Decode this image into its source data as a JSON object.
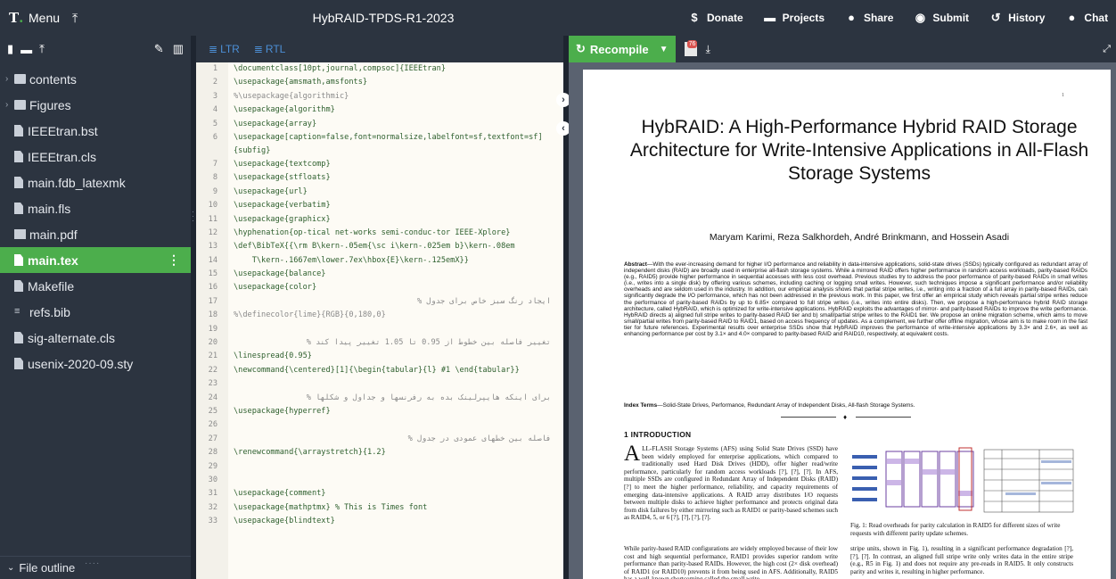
{
  "topbar": {
    "menu_label": "Menu",
    "title": "HybRAID-TPDS-R1-2023",
    "actions": [
      {
        "icon": "dollar-icon",
        "label": "Donate"
      },
      {
        "icon": "folder-icon",
        "label": "Projects"
      },
      {
        "icon": "users-icon",
        "label": "Share"
      },
      {
        "icon": "submit-icon",
        "label": "Submit"
      },
      {
        "icon": "history-icon",
        "label": "History"
      },
      {
        "icon": "chat-icon",
        "label": "Chat"
      }
    ]
  },
  "file_tree": {
    "items": [
      {
        "label": "contents",
        "type": "folder"
      },
      {
        "label": "Figures",
        "type": "folder"
      },
      {
        "label": "IEEEtran.bst",
        "type": "file"
      },
      {
        "label": "IEEEtran.cls",
        "type": "file"
      },
      {
        "label": "main.fdb_latexmk",
        "type": "file"
      },
      {
        "label": "main.fls",
        "type": "file"
      },
      {
        "label": "main.pdf",
        "type": "image"
      },
      {
        "label": "main.tex",
        "type": "file",
        "active": true
      },
      {
        "label": "Makefile",
        "type": "file"
      },
      {
        "label": "refs.bib",
        "type": "bib"
      },
      {
        "label": "sig-alternate.cls",
        "type": "file"
      },
      {
        "label": "usenix-2020-09.sty",
        "type": "file"
      }
    ],
    "outline_label": "File outline"
  },
  "editor": {
    "ltr_label": "LTR",
    "rtl_label": "RTL",
    "lines": [
      {
        "n": "1",
        "code": "\\documentclass[10pt,journal,compsoc]{IEEEtran}"
      },
      {
        "n": "2",
        "code": "\\usepackage{amsmath,amsfonts}"
      },
      {
        "n": "3",
        "code": "%\\usepackage{algorithmic}",
        "comment": true
      },
      {
        "n": "4",
        "code": "\\usepackage{algorithm}"
      },
      {
        "n": "5",
        "code": "\\usepackage{array}"
      },
      {
        "n": "6",
        "code": "\\usepackage[caption=false,font=normalsize,labelfont=sf,textfont=sf]",
        "code2": "{subfig}"
      },
      {
        "n": "7",
        "code": "\\usepackage{textcomp}"
      },
      {
        "n": "8",
        "code": "\\usepackage{stfloats}"
      },
      {
        "n": "9",
        "code": "\\usepackage{url}"
      },
      {
        "n": "10",
        "code": "\\usepackage{verbatim}"
      },
      {
        "n": "11",
        "code": "\\usepackage{graphicx}"
      },
      {
        "n": "12",
        "code": "\\hyphenation{op-tical net-works semi-conduc-tor IEEE-Xplore}"
      },
      {
        "n": "13",
        "code": "\\def\\BibTeX{{\\rm B\\kern-.05em{\\sc i\\kern-.025em b}\\kern-.08em"
      },
      {
        "n": "14",
        "code": "    T\\kern-.1667em\\lower.7ex\\hbox{E}\\kern-.125emX}}"
      },
      {
        "n": "15",
        "code": "\\usepackage{balance}"
      },
      {
        "n": "16",
        "code": "\\usepackage{color}"
      },
      {
        "n": "17",
        "code": "ایجاد رنگ سبز خاص برای جدول %",
        "comment": true,
        "rtl": true
      },
      {
        "n": "18",
        "code": "%\\definecolor{lime}{RGB}{0,180,0}",
        "comment": true
      },
      {
        "n": "19",
        "code": ""
      },
      {
        "n": "20",
        "code": "تغییر فاصله بین خطوط از 0.95 تا 1.05 تغییر پیدا کند %",
        "comment": true,
        "rtl": true
      },
      {
        "n": "21",
        "code": "\\linespread{0.95}"
      },
      {
        "n": "22",
        "code": "\\newcommand{\\centered}[1]{\\begin{tabular}{l} #1 \\end{tabular}}"
      },
      {
        "n": "23",
        "code": ""
      },
      {
        "n": "24",
        "code": "برای اینکه هایپرلینک بده به رفرنسها و جداول و شکلها %",
        "comment": true,
        "rtl": true
      },
      {
        "n": "25",
        "code": "\\usepackage{hyperref}"
      },
      {
        "n": "26",
        "code": ""
      },
      {
        "n": "27",
        "code": "فاصله بین خطهای عمودی در جدول %",
        "comment": true,
        "rtl": true
      },
      {
        "n": "28",
        "code": "\\renewcommand{\\arraystretch}{1.2}"
      },
      {
        "n": "29",
        "code": ""
      },
      {
        "n": "30",
        "code": ""
      },
      {
        "n": "31",
        "code": "\\usepackage{comment}"
      },
      {
        "n": "32",
        "code": "\\usepackage{mathptmx} % This is Times font"
      },
      {
        "n": "33",
        "code": "\\usepackage{blindtext}"
      }
    ]
  },
  "pdf": {
    "recompile_label": "Recompile",
    "badge_count": "76",
    "page_number": "1",
    "title": "HybRAID: A High-Performance Hybrid RAID Storage Architecture for Write-Intensive Applications in All-Flash Storage Systems",
    "authors": "Maryam Karimi, Reza Salkhordeh, André Brinkmann, and Hossein Asadi",
    "abstract_lead": "Abstract",
    "abstract_text": "—With the ever-increasing demand for higher I/O performance and reliability in data-intensive applications, solid-state drives (SSDs) typically configured as redundant array of independent disks (RAID) are broadly used in enterprise all-flash storage systems. While a mirrored RAID offers higher performance in random access workloads, parity-based RAIDs (e.g., RAID5) provide higher performance in sequential accesses with less cost overhead. Previous studies try to address the poor performance of parity-based RAIDs in small writes (i.e., writes into a single disk) by offering various schemes, including caching or logging small writes. However, such techniques impose a significant performance and/or reliability overheads and are seldom used in the industry. In addition, our empirical analysis shows that partial stripe writes, i.e., writing into a fraction of a full array in parity-based RAIDs, can significantly degrade the I/O performance, which has not been addressed in the previous work. In this paper, we first offer an empirical study which reveals partial stripe writes reduce the performance of parity-based RAIDs by up to 6.85× compared to full stripe writes (i.e., writes into entire disks). Then, we propose a high-performance hybrid RAID storage architecture, called HybRAID, which is optimized for write-intensive applications. HybRAID exploits the advantages of mirror- and parity-based RAIDs to improve the write performance. HybRAID directs a) aligned full stripe writes to parity-based RAID tier and b) small/partial stripe writes to the RAID1 tier. We propose an online migration scheme, which aims to move small/partial writes from parity-based RAID to RAID1, based on access frequency of updates. As a complement, we further offer offline migration, whose aim is to make room in the fast tier for future references. Experimental results over enterprise SSDs show that HybRAID improves the performance of write-intensive applications by 3.3× and 2.6×, as well as enhancing performance per cost by 3.1× and 4.0× compared to parity-based RAID and RAID10, respectively, at equivalent costs.",
    "index_lead": "Index Terms",
    "index_text": "—Solid-State Drives, Performance, Redundant Array of Independent Disks, All-flash Storage Systems.",
    "section_heading": "1   INTRODUCTION",
    "intro_dropcap": "A",
    "intro_text": "LL-FLASH Storage Systems (AFS) using Solid State Drives (SSD) have been widely employed for enterprise applications, which compared to traditionally used Hard Disk Drives (HDD), offer higher read/write performance, particularly for random access workloads [?], [?], [?]. In AFS, multiple SSDs are configured in Redundant Array of Independent Disks (RAID) [?] to meet the higher performance, reliability, and capacity requirements of emerging data-intensive applications. A RAID array distributes I/O requests between multiple disks to achieve higher performance and protects original data from disk failures by either mirroring such as RAID1 or parity-based schemes such as RAID4, 5, or 6 [?], [?], [?], [?].",
    "intro_text2": "While parity-based RAID configurations are widely employed because of their low cost and high sequential performance, RAID1 provides superior random write performance than parity-based RAIDs. However, the high cost (2× disk overhead) of RAID1 (or RAID10) prevents it from being used in AFS. Additionally, RAID5 has a well-known shortcoming called the small write",
    "col2_text": "stripe units, shown in Fig. 1), resulting in a significant performance degradation [?], [?], [?]. In contrast, an aligned full stripe write only writes data in the entire stripe (e.g., R5 in Fig. 1) and does not require any pre-reads in RAID5. It only constructs parity and writes it, resulting in higher performance.",
    "figure_caption": "Fig. 1: Read overheads for parity calculation in RAID5 for different sizes of write requests with different parity update schemes."
  },
  "colors": {
    "topbar_bg": "#2c3440",
    "accent_green": "#4cae4c",
    "editor_bg": "#fdfbf5",
    "ltr_blue": "#4c8fd6"
  }
}
